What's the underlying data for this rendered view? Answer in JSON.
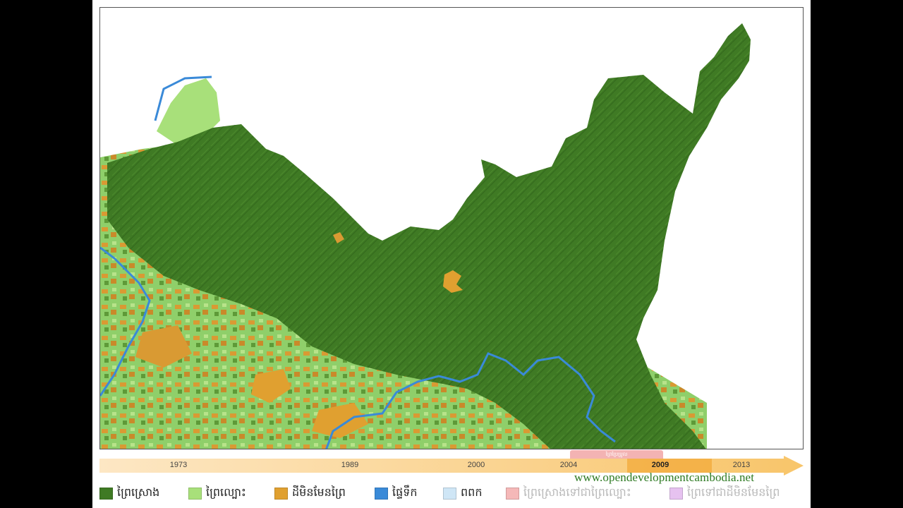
{
  "map": {
    "colors": {
      "evergreen_forest": "#3f7a24",
      "deciduous_forest": "#a8e07a",
      "non_forest": "#e0a030",
      "water": "#3a8ad8",
      "cloud": "#cfe6f6",
      "evergreen_to_deciduous": "#f5b8b8",
      "forest_to_non_forest": "#e6c2f0"
    }
  },
  "timeline": {
    "years": [
      "1973",
      "1989",
      "2000",
      "2004",
      "2009",
      "2013"
    ],
    "active_year": "2009",
    "period_tab_label": "ព្រៃប្រែប្រួល"
  },
  "source_credit": "www.opendevelopmentcambodia.net",
  "legend": {
    "items": [
      {
        "label": "ព្រៃស្រោង",
        "color": "#3f7a24",
        "faded": false
      },
      {
        "label": "ព្រៃល្បោះ",
        "color": "#a8e07a",
        "faded": false
      },
      {
        "label": "ដីមិនមែនព្រៃ",
        "color": "#e0a030",
        "faded": false
      },
      {
        "label": "ផ្ទៃទឹក",
        "color": "#3a8ad8",
        "faded": false
      },
      {
        "label": "ពពក",
        "color": "#cfe6f6",
        "faded": false
      },
      {
        "label": "ព្រៃស្រោងទៅជាព្រៃល្បោះ",
        "color": "#f5b8b8",
        "faded": true
      },
      {
        "label": "ព្រៃទៅជាដីមិនមែនព្រៃ",
        "color": "#e6c2f0",
        "faded": true
      }
    ]
  }
}
